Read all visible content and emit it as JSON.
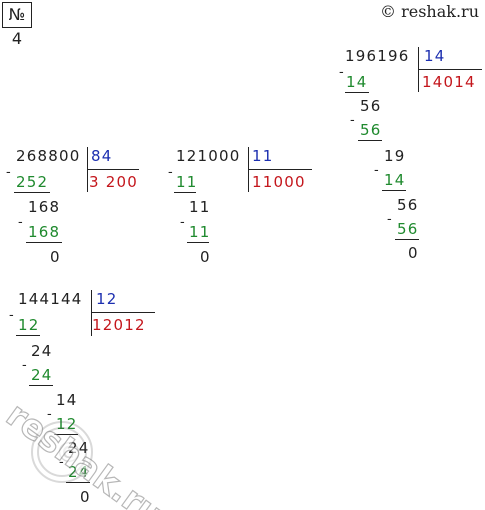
{
  "header": {
    "task_label": "№ 4",
    "source": "© reshak.ru"
  },
  "watermark_text": "reshak.ru",
  "divisions": [
    {
      "dividend": "196196",
      "divisor": "14",
      "quotient": "14014",
      "steps": [
        "14",
        "56",
        "56",
        "19",
        "14",
        "56",
        "56",
        "0"
      ]
    },
    {
      "dividend": "268800",
      "divisor": "84",
      "quotient": "3 200",
      "steps": [
        "252",
        "168",
        "168",
        "0"
      ]
    },
    {
      "dividend": "121000",
      "divisor": "11",
      "quotient": "11000",
      "steps": [
        "11",
        "11",
        "11",
        "0"
      ]
    },
    {
      "dividend": "144144",
      "divisor": "12",
      "quotient": "12012",
      "steps": [
        "12",
        "24",
        "24",
        "14",
        "12",
        "24",
        "24",
        "0"
      ]
    }
  ]
}
